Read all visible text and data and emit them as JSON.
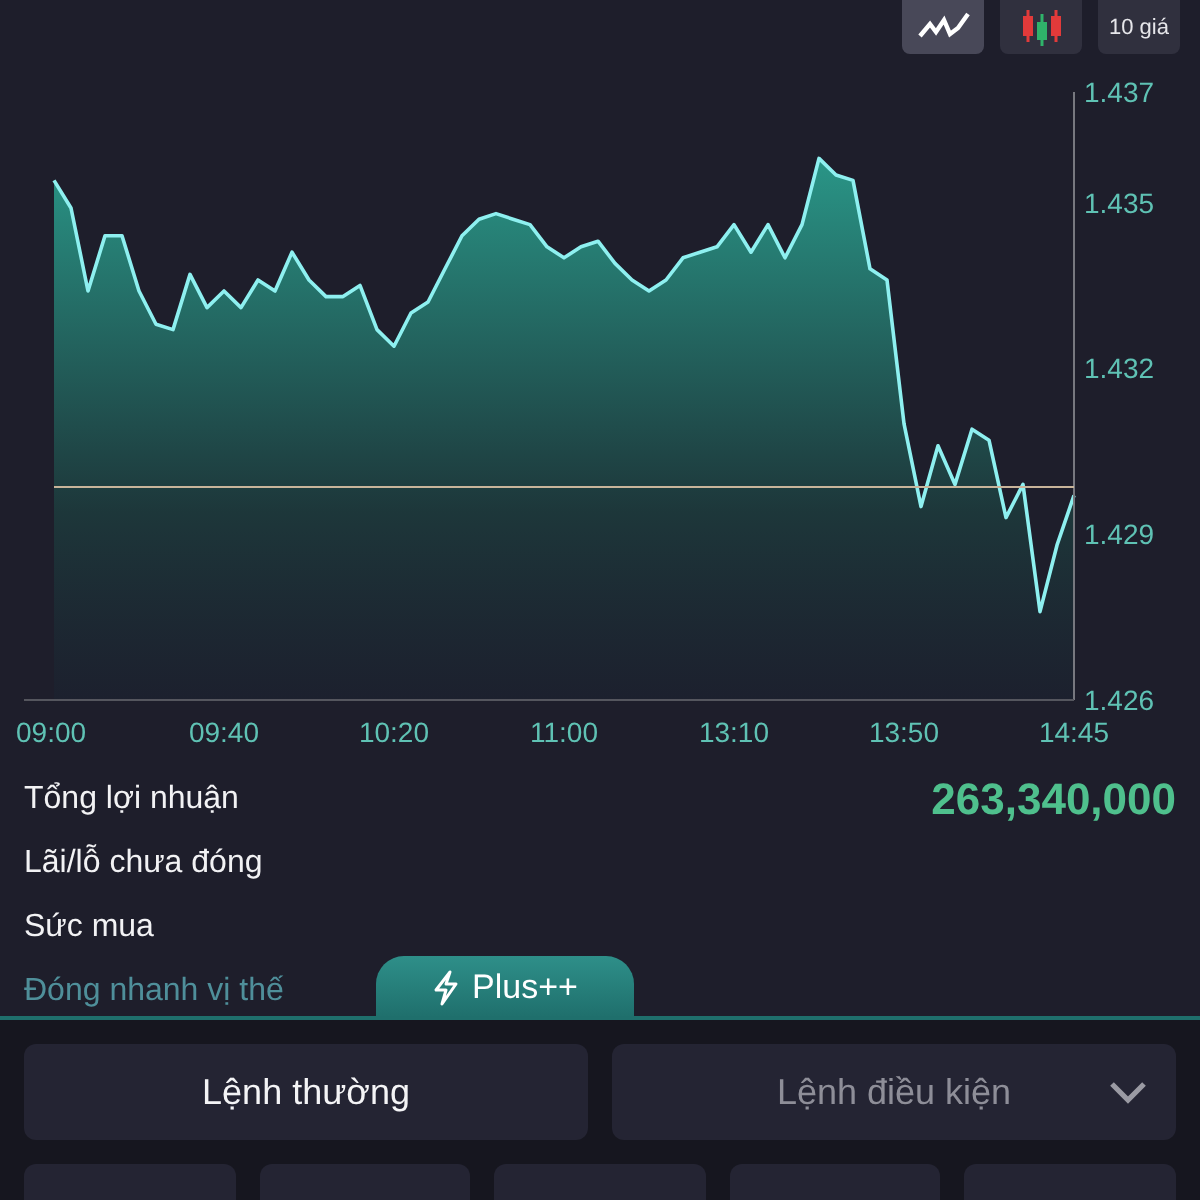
{
  "toolbar": [
    {
      "kind": "line-chart",
      "selected": true
    },
    {
      "kind": "candle-chart",
      "selected": false
    },
    {
      "kind": "text",
      "label": "10 giá",
      "selected": false
    }
  ],
  "chart": {
    "chart_data": {
      "type": "area",
      "ylim": [
        1.426,
        1.437
      ],
      "categories": [
        "09:00",
        null,
        null,
        null,
        null,
        null,
        null,
        null,
        null,
        null,
        "09:40",
        null,
        null,
        null,
        null,
        null,
        null,
        null,
        null,
        null,
        "10:20",
        null,
        null,
        null,
        null,
        null,
        null,
        null,
        null,
        null,
        "11:00",
        null,
        null,
        null,
        null,
        null,
        null,
        null,
        null,
        null,
        "13:10",
        null,
        null,
        null,
        null,
        null,
        null,
        null,
        null,
        null,
        "13:50",
        null,
        null,
        null,
        null,
        null,
        null,
        null,
        null,
        null,
        "14:45"
      ],
      "yticks": [
        1.437,
        1.435,
        1.432,
        1.429,
        1.426
      ],
      "series": [
        {
          "color": "#8ef0f0",
          "values": [
            1.4354,
            1.4349,
            1.4334,
            1.4344,
            1.4344,
            1.4334,
            1.4328,
            1.4327,
            1.4337,
            1.4331,
            1.4334,
            1.4331,
            1.4336,
            1.4334,
            1.4341,
            1.4336,
            1.4333,
            1.4333,
            1.4335,
            1.4327,
            1.4324,
            1.433,
            1.4332,
            1.4338,
            1.4344,
            1.4347,
            1.4348,
            1.4347,
            1.4346,
            1.4342,
            1.434,
            1.4342,
            1.4343,
            1.4339,
            1.4336,
            1.4334,
            1.4336,
            1.434,
            1.4341,
            1.4342,
            1.4346,
            1.4341,
            1.4346,
            1.434,
            1.4346,
            1.4358,
            1.4355,
            1.4354,
            1.4338,
            1.4336,
            1.431,
            1.4295,
            1.4306,
            1.4299,
            1.4309,
            1.4307,
            1.4293,
            1.4299,
            1.4276,
            1.4288,
            1.4297
          ]
        }
      ]
    }
  },
  "summary": [
    {
      "label": "Tổng lợi nhuận",
      "value": "263,340,000"
    },
    {
      "label": "Lãi/lỗ chưa đóng"
    },
    {
      "label": "Sức mua"
    }
  ],
  "quick_close_link": "Đóng nhanh vị thế",
  "plus_tab": "Plus++",
  "order_tabs": [
    {
      "label": "Lệnh thường",
      "selected": true,
      "dropdown": false
    },
    {
      "label": "Lệnh điều kiện",
      "selected": false,
      "dropdown": true
    }
  ],
  "price_buttons": [
    {
      "kind": "blank"
    },
    {
      "kind": "blank"
    },
    {
      "kind": "blank"
    },
    {
      "kind": "blank"
    },
    {
      "kind": "blank"
    }
  ]
}
